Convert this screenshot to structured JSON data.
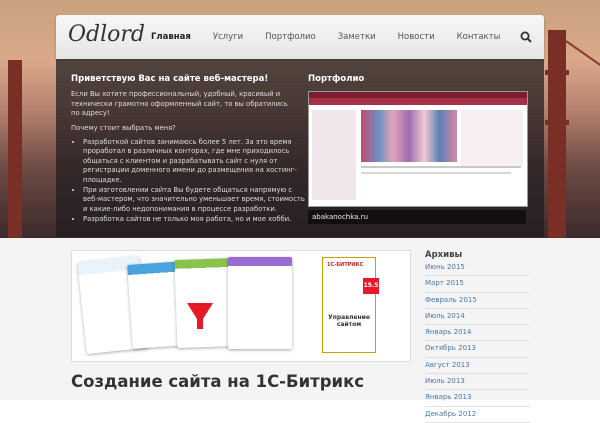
{
  "site": {
    "logo": "Odlord"
  },
  "nav": {
    "items": [
      {
        "label": "Главная",
        "active": true
      },
      {
        "label": "Услуги",
        "active": false
      },
      {
        "label": "Портфолио",
        "active": false
      },
      {
        "label": "Заметки",
        "active": false
      },
      {
        "label": "Новости",
        "active": false
      },
      {
        "label": "Контакты",
        "active": false
      }
    ],
    "search_icon": "search-icon"
  },
  "welcome": {
    "title": "Приветствую Вас на сайте веб-мастера!",
    "intro": "Если Вы хотите профессиональный, удобный, красивый и технически грамотно оформленный сайт, то вы обратились по адресу!",
    "why": "Почему стоит выбрать меня?",
    "bullets": [
      "Разработкой сайтов занимаюсь более 5 лет. За это время проработал в различных конторах, где мне приходилось общаться с клиентом и разрабатывать сайт с нуля от регистрации доменного имени до размещения на хостинг-площадке.",
      "При изготовлении сайта Вы будете общаться напрямую с веб-мастером, что значительно уменьшает время, стоимость и какие-либо недопонимания в процессе разработки.",
      "Разработка сайтов не только моя работа, но и мое хобби."
    ]
  },
  "portfolio": {
    "title": "Портфолио",
    "caption": "abakanochka.ru"
  },
  "feature": {
    "box_brand": "1С-БИТРИКС",
    "box_title": "Управление сайтом",
    "box_badge": "15.5"
  },
  "post": {
    "title": "Создание сайта на 1С-Битрикс"
  },
  "sidebar": {
    "title": "Архивы",
    "archives": [
      "Июнь 2015",
      "Март 2015",
      "Февраль 2015",
      "Июль 2014",
      "Январь 2014",
      "Октябрь 2013",
      "Август 2013",
      "Июль 2013",
      "Январь 2013",
      "Декабрь 2012"
    ]
  },
  "colors": {
    "link": "#4a78a8",
    "panel": "#1e1c1e",
    "brand_red": "#e6192b"
  }
}
